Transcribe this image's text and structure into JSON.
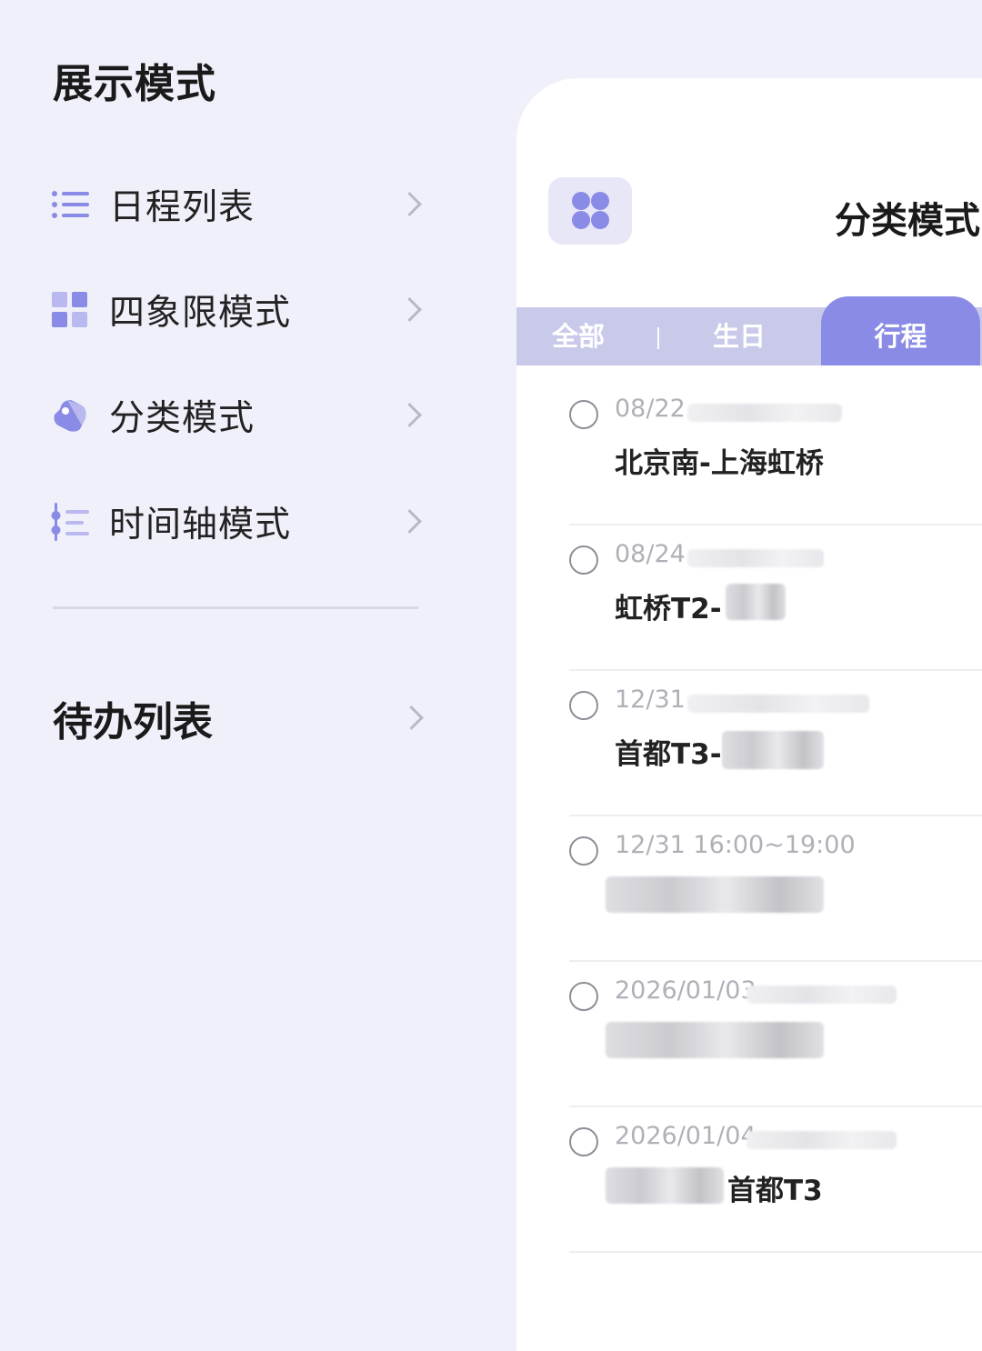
{
  "display_modes": {
    "title": "展示模式",
    "items": [
      {
        "label": "日程列表",
        "icon": "list-icon"
      },
      {
        "label": "四象限模式",
        "icon": "quadrant-icon"
      },
      {
        "label": "分类模式",
        "icon": "tag-icon"
      },
      {
        "label": "时间轴模式",
        "icon": "timeline-icon"
      }
    ]
  },
  "todo": {
    "title": "待办列表"
  },
  "preview": {
    "title": "分类模式",
    "tabs": [
      {
        "label": "全部",
        "active": false
      },
      {
        "label": "生日",
        "active": false
      },
      {
        "label": "行程",
        "active": true
      }
    ],
    "events": [
      {
        "date": "08/22",
        "title": "北京南-上海虹桥"
      },
      {
        "date": "08/24",
        "title": "虹桥T2-"
      },
      {
        "date": "12/31",
        "title": "首都T3-"
      },
      {
        "date": "12/31 16:00~19:00",
        "title": ""
      },
      {
        "date": "2026/01/03",
        "title": ""
      },
      {
        "date": "2026/01/04",
        "title": "首都T3"
      }
    ]
  },
  "colors": {
    "accent": "#8a8be6",
    "background": "#f0f0fa",
    "tab_inactive": "#c9c9ea"
  }
}
